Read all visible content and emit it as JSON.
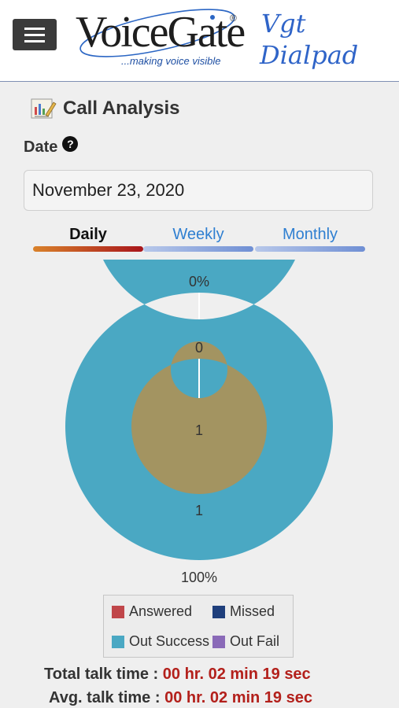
{
  "header": {
    "logo_text": "VoiceGate",
    "logo_reg": "®",
    "logo_tagline": "...making voice visible",
    "app_title_line1": "Vgt",
    "app_title_line2": "Dialpad"
  },
  "page": {
    "section_title": "Call Analysis",
    "date_label": "Date",
    "help_glyph": "?",
    "date_value": "November 23, 2020"
  },
  "tabs": [
    {
      "label": "Daily",
      "active": true
    },
    {
      "label": "Weekly",
      "active": false
    },
    {
      "label": "Monthly",
      "active": false
    }
  ],
  "colors": {
    "answered": "#c0464a",
    "missed": "#1f3f7c",
    "out_success": "#4aa8c3",
    "out_fail": "#8a6ab8",
    "inner_ring": "#a39461",
    "value_red": "#b3201b"
  },
  "chart_data": {
    "type": "pie",
    "outer_ring": {
      "top_label": "0%",
      "bottom_label": "100%",
      "slices": [
        {
          "name": "Out Success",
          "value": 100
        }
      ]
    },
    "inner_ring": {
      "top_label": "0",
      "bottom_label": "1",
      "center_label": "1",
      "slices": [
        {
          "value": 1
        }
      ]
    }
  },
  "legend": {
    "answered": "Answered",
    "missed": "Missed",
    "out_success": "Out Success",
    "out_fail": "Out Fail"
  },
  "stats": {
    "total_label": "Total talk time :",
    "total_value": "00 hr. 02 min 19 sec",
    "avg_label": "Avg. talk time :",
    "avg_value": "00 hr. 02 min 19 sec"
  }
}
